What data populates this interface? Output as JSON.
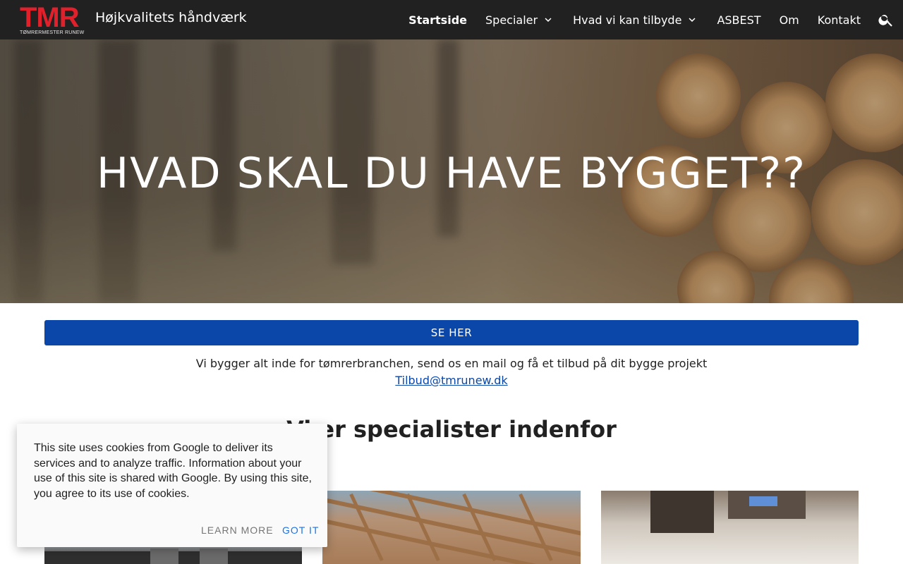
{
  "header": {
    "logo_text": "TMR",
    "logo_subtext": "TØMRERMESTER RUNEW",
    "site_title": "Højkvalitets håndværk",
    "nav": [
      {
        "label": "Startside",
        "active": true
      },
      {
        "label": "Specialer",
        "dropdown": true
      },
      {
        "label": "Hvad vi kan tilbyde",
        "dropdown": true
      },
      {
        "label": "ASBEST"
      },
      {
        "label": "Om"
      },
      {
        "label": "Kontakt"
      }
    ],
    "search_icon": "search-icon"
  },
  "hero": {
    "title": "HVAD SKAL DU HAVE BYGGET??"
  },
  "main": {
    "cta_label": "SE HER",
    "intro_text": "Vi bygger alt inde for tømrerbranchen, send os en mail og få et tilbud på dit bygge projekt",
    "email": "Tilbud@tmrunew.dk",
    "section_title": "Vi er specialister indenfor"
  },
  "cookie": {
    "text": "This site uses cookies from Google to deliver its services and to analyze traffic. Information about your use of this site is shared with Google. By using this site, you agree to its use of cookies.",
    "learn_more": "LEARN MORE",
    "got_it": "GOT IT"
  },
  "colors": {
    "header_bg": "#212121",
    "accent_blue": "#0a47a8",
    "logo_red": "#e0202b",
    "cookie_action": "#1a73e8"
  }
}
